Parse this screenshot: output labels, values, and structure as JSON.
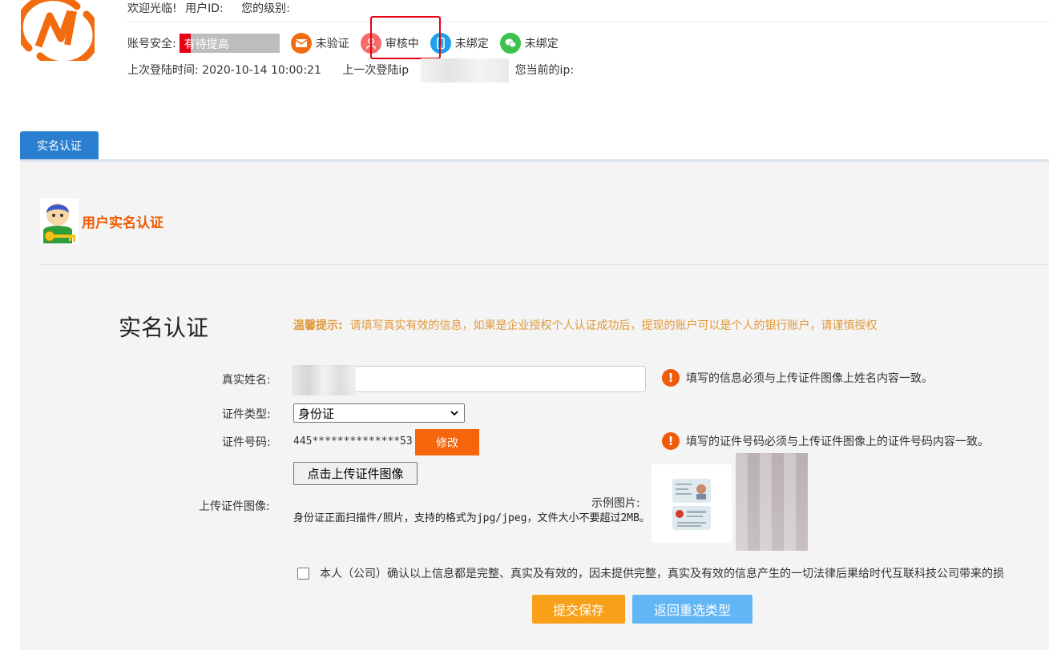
{
  "header": {
    "welcome": "欢迎光临!",
    "user_id_label": "用户ID:",
    "level_label": "您的级别:",
    "security_label": "账号安全:",
    "security_level": "有待提高",
    "email_status": "未验证",
    "realname_status": "审核中",
    "phone_status": "未绑定",
    "wechat_status": "未绑定",
    "last_login_label": "上次登陆时间:",
    "last_login_time": "2020-10-14 10:00:21",
    "last_ip_label": "上一次登陆ip",
    "current_ip_label": "您当前的ip:",
    "colors": {
      "email": "#f36c0f",
      "realname": "#f46b6b",
      "phone": "#1fa1ea",
      "wechat": "#3cc24d"
    }
  },
  "tab": {
    "label": "实名认证"
  },
  "section": {
    "title": "用户实名认证"
  },
  "form": {
    "title": "实名认证",
    "tip_label": "温馨提示:",
    "tip_text": "请填写真实有效的信息，如果是企业授权个人认证成功后，提现的账户可以是个人的银行账户，请谨慎授权",
    "name_label": "真实姓名:",
    "name_warning": "填写的信息必须与上传证件图像上姓名内容一致。",
    "id_type_label": "证件类型:",
    "id_type_value": "身份证",
    "id_number_label": "证件号码:",
    "id_number_value": "445**************53",
    "modify_button": "修改",
    "id_number_warning": "填写的证件号码必须与上传证件图像上的证件号码内容一致。",
    "upload_label": "上传证件图像:",
    "upload_button": "点击上传证件图像",
    "upload_desc": "身份证正面扫描件/照片，支持的格式为jpg/jpeg，文件大小不要超过2MB。",
    "sample_label": "示例图片:",
    "agree_text": "本人（公司）确认以上信息都是完整、真实及有效的，因未提供完整，真实及有效的信息产生的一切法律后果给时代互联科技公司带来的损",
    "submit_button": "提交保存",
    "back_button": "返回重选类型"
  }
}
